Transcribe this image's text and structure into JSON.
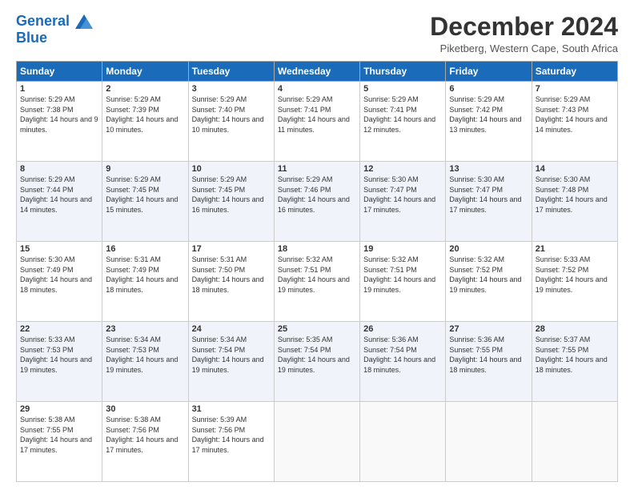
{
  "logo": {
    "line1": "General",
    "line2": "Blue"
  },
  "title": "December 2024",
  "location": "Piketberg, Western Cape, South Africa",
  "days_header": [
    "Sunday",
    "Monday",
    "Tuesday",
    "Wednesday",
    "Thursday",
    "Friday",
    "Saturday"
  ],
  "weeks": [
    [
      {
        "day": "1",
        "sunrise": "5:29 AM",
        "sunset": "7:38 PM",
        "daylight": "14 hours and 9 minutes."
      },
      {
        "day": "2",
        "sunrise": "5:29 AM",
        "sunset": "7:39 PM",
        "daylight": "14 hours and 10 minutes."
      },
      {
        "day": "3",
        "sunrise": "5:29 AM",
        "sunset": "7:40 PM",
        "daylight": "14 hours and 10 minutes."
      },
      {
        "day": "4",
        "sunrise": "5:29 AM",
        "sunset": "7:41 PM",
        "daylight": "14 hours and 11 minutes."
      },
      {
        "day": "5",
        "sunrise": "5:29 AM",
        "sunset": "7:41 PM",
        "daylight": "14 hours and 12 minutes."
      },
      {
        "day": "6",
        "sunrise": "5:29 AM",
        "sunset": "7:42 PM",
        "daylight": "14 hours and 13 minutes."
      },
      {
        "day": "7",
        "sunrise": "5:29 AM",
        "sunset": "7:43 PM",
        "daylight": "14 hours and 14 minutes."
      }
    ],
    [
      {
        "day": "8",
        "sunrise": "5:29 AM",
        "sunset": "7:44 PM",
        "daylight": "14 hours and 14 minutes."
      },
      {
        "day": "9",
        "sunrise": "5:29 AM",
        "sunset": "7:45 PM",
        "daylight": "14 hours and 15 minutes."
      },
      {
        "day": "10",
        "sunrise": "5:29 AM",
        "sunset": "7:45 PM",
        "daylight": "14 hours and 16 minutes."
      },
      {
        "day": "11",
        "sunrise": "5:29 AM",
        "sunset": "7:46 PM",
        "daylight": "14 hours and 16 minutes."
      },
      {
        "day": "12",
        "sunrise": "5:30 AM",
        "sunset": "7:47 PM",
        "daylight": "14 hours and 17 minutes."
      },
      {
        "day": "13",
        "sunrise": "5:30 AM",
        "sunset": "7:47 PM",
        "daylight": "14 hours and 17 minutes."
      },
      {
        "day": "14",
        "sunrise": "5:30 AM",
        "sunset": "7:48 PM",
        "daylight": "14 hours and 17 minutes."
      }
    ],
    [
      {
        "day": "15",
        "sunrise": "5:30 AM",
        "sunset": "7:49 PM",
        "daylight": "14 hours and 18 minutes."
      },
      {
        "day": "16",
        "sunrise": "5:31 AM",
        "sunset": "7:49 PM",
        "daylight": "14 hours and 18 minutes."
      },
      {
        "day": "17",
        "sunrise": "5:31 AM",
        "sunset": "7:50 PM",
        "daylight": "14 hours and 18 minutes."
      },
      {
        "day": "18",
        "sunrise": "5:32 AM",
        "sunset": "7:51 PM",
        "daylight": "14 hours and 19 minutes."
      },
      {
        "day": "19",
        "sunrise": "5:32 AM",
        "sunset": "7:51 PM",
        "daylight": "14 hours and 19 minutes."
      },
      {
        "day": "20",
        "sunrise": "5:32 AM",
        "sunset": "7:52 PM",
        "daylight": "14 hours and 19 minutes."
      },
      {
        "day": "21",
        "sunrise": "5:33 AM",
        "sunset": "7:52 PM",
        "daylight": "14 hours and 19 minutes."
      }
    ],
    [
      {
        "day": "22",
        "sunrise": "5:33 AM",
        "sunset": "7:53 PM",
        "daylight": "14 hours and 19 minutes."
      },
      {
        "day": "23",
        "sunrise": "5:34 AM",
        "sunset": "7:53 PM",
        "daylight": "14 hours and 19 minutes."
      },
      {
        "day": "24",
        "sunrise": "5:34 AM",
        "sunset": "7:54 PM",
        "daylight": "14 hours and 19 minutes."
      },
      {
        "day": "25",
        "sunrise": "5:35 AM",
        "sunset": "7:54 PM",
        "daylight": "14 hours and 19 minutes."
      },
      {
        "day": "26",
        "sunrise": "5:36 AM",
        "sunset": "7:54 PM",
        "daylight": "14 hours and 18 minutes."
      },
      {
        "day": "27",
        "sunrise": "5:36 AM",
        "sunset": "7:55 PM",
        "daylight": "14 hours and 18 minutes."
      },
      {
        "day": "28",
        "sunrise": "5:37 AM",
        "sunset": "7:55 PM",
        "daylight": "14 hours and 18 minutes."
      }
    ],
    [
      {
        "day": "29",
        "sunrise": "5:38 AM",
        "sunset": "7:55 PM",
        "daylight": "14 hours and 17 minutes."
      },
      {
        "day": "30",
        "sunrise": "5:38 AM",
        "sunset": "7:56 PM",
        "daylight": "14 hours and 17 minutes."
      },
      {
        "day": "31",
        "sunrise": "5:39 AM",
        "sunset": "7:56 PM",
        "daylight": "14 hours and 17 minutes."
      },
      null,
      null,
      null,
      null
    ]
  ],
  "labels": {
    "sunrise": "Sunrise:",
    "sunset": "Sunset:",
    "daylight": "Daylight:"
  }
}
